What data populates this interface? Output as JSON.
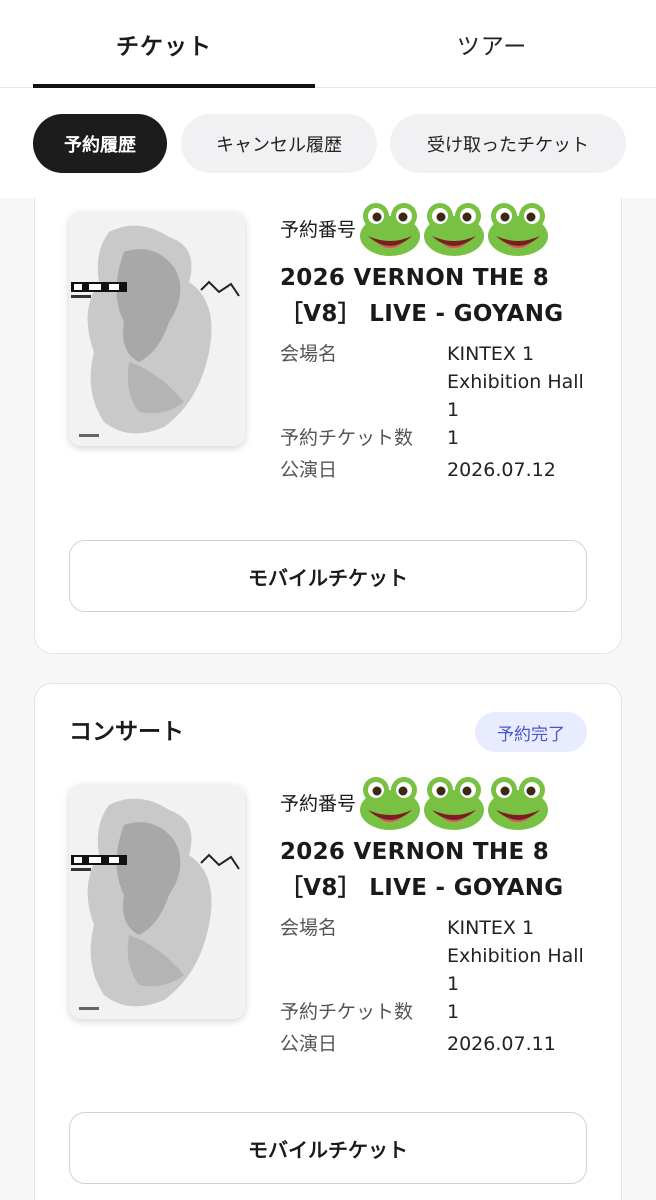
{
  "tabs": {
    "tickets": "チケット",
    "tours": "ツアー"
  },
  "filters": {
    "reservation_history": "予約履歴",
    "cancel_history": "キャンセル履歴",
    "received_tickets": "受け取ったチケット"
  },
  "cards": [
    {
      "reservation_label": "予約番号",
      "reservation_emoji": "frog-face x3",
      "title_line1": "2026 VERNON THE 8",
      "title_line2": "［V8］ LIVE - GOYANG",
      "venue_label": "会場名",
      "venue_value": "KINTEX 1 Exhibition Hall 1",
      "count_label": "予約チケット数",
      "count_value": "1",
      "date_label": "公演日",
      "date_value": "2026.07.12",
      "button_label": "モバイルチケット"
    },
    {
      "category": "コンサート",
      "status": "予約完了",
      "reservation_label": "予約番号",
      "reservation_emoji": "frog-face x3",
      "title_line1": "2026 VERNON THE 8",
      "title_line2": "［V8］ LIVE - GOYANG",
      "venue_label": "会場名",
      "venue_value": "KINTEX 1 Exhibition Hall 1",
      "count_label": "予約チケット数",
      "count_value": "1",
      "date_label": "公演日",
      "date_value": "2026.07.11",
      "button_label": "モバイルチケット"
    }
  ],
  "colors": {
    "active_chip": "#1c1c1c",
    "badge_bg": "#e9ecff",
    "badge_text": "#4a57c8",
    "frog": "#7ac943"
  }
}
